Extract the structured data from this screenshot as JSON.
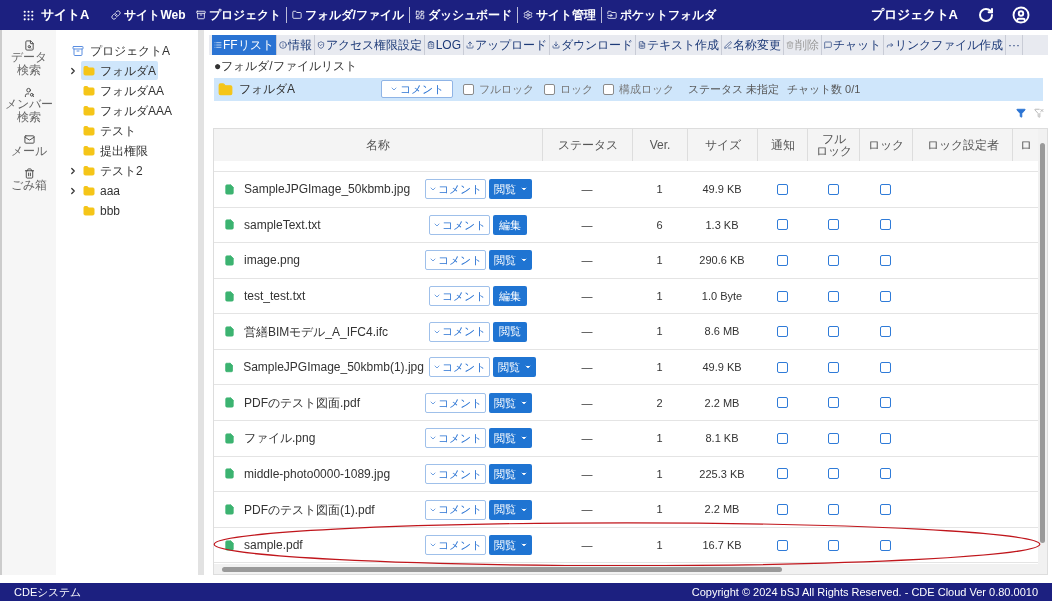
{
  "topbar": {
    "logo": "サイトA",
    "links": [
      {
        "label": "サイトWeb"
      },
      {
        "label": "プロジェクト"
      },
      {
        "label": "フォルダ/ファイル"
      },
      {
        "label": "ダッシュボード"
      },
      {
        "label": "サイト管理"
      },
      {
        "label": "ポケットフォルダ"
      }
    ],
    "project": "プロジェクトA"
  },
  "rail": [
    {
      "lines": [
        "データ",
        "検索"
      ]
    },
    {
      "lines": [
        "メンバー",
        "検索"
      ]
    },
    {
      "lines": [
        "メール"
      ]
    },
    {
      "lines": [
        "ごみ箱"
      ]
    }
  ],
  "tree": {
    "label": "プロジェクトA",
    "children": [
      {
        "label": "フォルダA",
        "expandable": true,
        "selected": true
      },
      {
        "label": "フォルダAA",
        "expandable": false,
        "selected": false
      },
      {
        "label": "フォルダAAA",
        "expandable": false,
        "selected": false
      },
      {
        "label": "テスト",
        "expandable": false,
        "selected": false
      },
      {
        "label": "提出権限",
        "expandable": false,
        "selected": false
      },
      {
        "label": "テスト2",
        "expandable": true,
        "selected": false
      },
      {
        "label": "aaa",
        "expandable": true,
        "selected": false
      },
      {
        "label": "bbb",
        "expandable": false,
        "selected": false
      }
    ]
  },
  "toolbar": [
    {
      "label": "FFリスト",
      "selected": true,
      "disabled": false
    },
    {
      "label": "情報",
      "selected": false,
      "disabled": false
    },
    {
      "label": "アクセス権限設定",
      "selected": false,
      "disabled": false
    },
    {
      "label": "LOG",
      "selected": false,
      "disabled": false
    },
    {
      "label": "アップロード",
      "selected": false,
      "disabled": false
    },
    {
      "label": "ダウンロード",
      "selected": false,
      "disabled": false
    },
    {
      "label": "テキスト作成",
      "selected": false,
      "disabled": false
    },
    {
      "label": "名称変更",
      "selected": false,
      "disabled": false
    },
    {
      "label": "削除",
      "selected": false,
      "disabled": true
    },
    {
      "label": "チャット",
      "selected": false,
      "disabled": false
    },
    {
      "label": "リンクファイル作成",
      "selected": false,
      "disabled": false
    },
    {
      "label": "···",
      "selected": false,
      "disabled": false
    }
  ],
  "section_title": "●フォルダ/ファイルリスト",
  "folder_bar": {
    "name": "フォルダA",
    "comment": "コメント",
    "checkboxes": [
      {
        "label": "フルロック",
        "checked": false
      },
      {
        "label": "ロック",
        "checked": false
      },
      {
        "label": "構成ロック",
        "checked": false
      }
    ],
    "status": "ステータス 未指定",
    "chat": "チャット数 0/1"
  },
  "table": {
    "columns": [
      {
        "lines": [
          "名称"
        ]
      },
      {
        "lines": [
          "ステータス"
        ]
      },
      {
        "lines": [
          "Ver."
        ]
      },
      {
        "lines": [
          "サイズ"
        ]
      },
      {
        "lines": [
          "通知"
        ]
      },
      {
        "lines": [
          "フル",
          "ロック"
        ]
      },
      {
        "lines": [
          "ロック"
        ]
      },
      {
        "lines": [
          "ロック設定者"
        ]
      },
      {
        "lines": [
          "ロ"
        ]
      }
    ],
    "rows": [
      {
        "name": "SampleJPGImage_50kbmb.jpg",
        "comment": "コメント",
        "action": "閲覧",
        "split": true,
        "status": "—",
        "ver": "1",
        "size": "49.9 KB",
        "notify": false,
        "full_lock": false,
        "lock": false,
        "circled": false
      },
      {
        "name": "sampleText.txt",
        "comment": "コメント",
        "action": "編集",
        "split": false,
        "status": "—",
        "ver": "6",
        "size": "1.3 KB",
        "notify": false,
        "full_lock": false,
        "lock": false,
        "circled": false
      },
      {
        "name": "image.png",
        "comment": "コメント",
        "action": "閲覧",
        "split": true,
        "status": "—",
        "ver": "1",
        "size": "290.6 KB",
        "notify": false,
        "full_lock": false,
        "lock": false,
        "circled": false
      },
      {
        "name": "test_test.txt",
        "comment": "コメント",
        "action": "編集",
        "split": false,
        "status": "—",
        "ver": "1",
        "size": "1.0 Byte",
        "notify": false,
        "full_lock": false,
        "lock": false,
        "circled": false
      },
      {
        "name": "営繕BIMモデル_A_IFC4.ifc",
        "comment": "コメント",
        "action": "閲覧",
        "split": false,
        "status": "—",
        "ver": "1",
        "size": "8.6 MB",
        "notify": false,
        "full_lock": false,
        "lock": false,
        "circled": false
      },
      {
        "name": "SampleJPGImage_50kbmb(1).jpg",
        "comment": "コメント",
        "action": "閲覧",
        "split": true,
        "status": "—",
        "ver": "1",
        "size": "49.9 KB",
        "notify": false,
        "full_lock": false,
        "lock": false,
        "circled": false
      },
      {
        "name": "PDFのテスト図面.pdf",
        "comment": "コメント",
        "action": "閲覧",
        "split": true,
        "status": "—",
        "ver": "2",
        "size": "2.2 MB",
        "notify": false,
        "full_lock": false,
        "lock": false,
        "circled": false
      },
      {
        "name": "ファイル.png",
        "comment": "コメント",
        "action": "閲覧",
        "split": true,
        "status": "—",
        "ver": "1",
        "size": "8.1 KB",
        "notify": false,
        "full_lock": false,
        "lock": false,
        "circled": false
      },
      {
        "name": "middle-photo0000-1089.jpg",
        "comment": "コメント",
        "action": "閲覧",
        "split": true,
        "status": "—",
        "ver": "1",
        "size": "225.3 KB",
        "notify": false,
        "full_lock": false,
        "lock": false,
        "circled": false
      },
      {
        "name": "PDFのテスト図面(1).pdf",
        "comment": "コメント",
        "action": "閲覧",
        "split": true,
        "status": "—",
        "ver": "1",
        "size": "2.2 MB",
        "notify": false,
        "full_lock": false,
        "lock": false,
        "circled": false
      },
      {
        "name": "sample.pdf",
        "comment": "コメント",
        "action": "閲覧",
        "split": true,
        "status": "—",
        "ver": "1",
        "size": "16.7 KB",
        "notify": false,
        "full_lock": false,
        "lock": false,
        "circled": true
      }
    ]
  },
  "footer": {
    "left": "CDEシステム",
    "right": "Copyright © 2024 bSJ All Rights Reserved. - CDE Cloud Ver 0.80.0010"
  }
}
